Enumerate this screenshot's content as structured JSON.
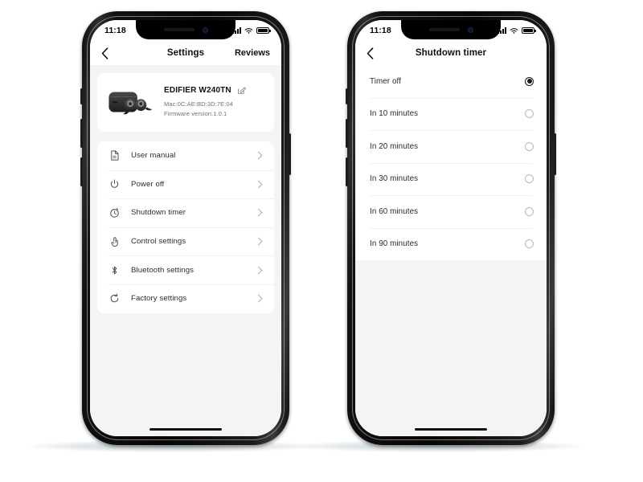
{
  "phones": {
    "left": {
      "status_bar": {
        "time": "11:18",
        "signal_icon": "signal-bars-icon",
        "wifi_icon": "wifi-icon",
        "battery_icon": "battery-icon"
      },
      "nav": {
        "back_icon": "back-chevron-icon",
        "title": "Settings",
        "action_label": "Reviews"
      },
      "device": {
        "image_icon": "earbuds-case-icon",
        "name": "EDIFIER W240TN",
        "edit_icon": "edit-pencil-icon",
        "mac": "Mac:0C:AE:BD:3D:7E:04",
        "firmware": "Firmware version:1.0.1"
      },
      "menu": [
        {
          "icon": "document-icon",
          "label": "User manual"
        },
        {
          "icon": "power-icon",
          "label": "Power off"
        },
        {
          "icon": "timer-icon",
          "label": "Shutdown timer"
        },
        {
          "icon": "touch-icon",
          "label": "Control settings"
        },
        {
          "icon": "bluetooth-icon",
          "label": "Bluetooth settings"
        },
        {
          "icon": "reset-icon",
          "label": "Factory settings"
        }
      ]
    },
    "right": {
      "status_bar": {
        "time": "11:18",
        "signal_icon": "signal-bars-icon",
        "wifi_icon": "wifi-icon",
        "battery_icon": "battery-icon"
      },
      "nav": {
        "back_icon": "back-chevron-icon",
        "title": "Shutdown timer",
        "action_label": ""
      },
      "options": [
        {
          "label": "Timer off",
          "selected": true
        },
        {
          "label": "In 10 minutes",
          "selected": false
        },
        {
          "label": "In 20 minutes",
          "selected": false
        },
        {
          "label": "In 30 minutes",
          "selected": false
        },
        {
          "label": "In 60 minutes",
          "selected": false
        },
        {
          "label": "In 90 minutes",
          "selected": false
        }
      ]
    }
  },
  "colors": {
    "page_background": "#ffffff",
    "screen_background": "#f2f4f6",
    "card": "#ffffff",
    "primary_text": "#101010",
    "secondary_text": "#6f7478",
    "divider": "#f0f1f2",
    "chevron": "#a9adb1"
  }
}
